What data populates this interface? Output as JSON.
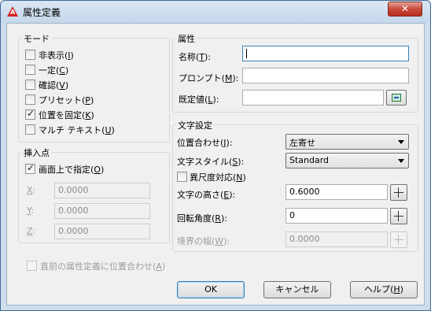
{
  "window": {
    "title": "属性定義",
    "close_label": "✕"
  },
  "mode": {
    "title": "モード",
    "items": [
      {
        "label": "非表示",
        "key": "I",
        "checked": false
      },
      {
        "label": "一定",
        "key": "C",
        "checked": false
      },
      {
        "label": "確認",
        "key": "V",
        "checked": false
      },
      {
        "label": "プリセット",
        "key": "P",
        "checked": false
      },
      {
        "label": "位置を固定",
        "key": "K",
        "checked": true
      },
      {
        "label": "マルチ テキスト",
        "key": "U",
        "checked": false
      }
    ]
  },
  "insertion": {
    "title": "挿入点",
    "specify_on_screen": {
      "label": "画面上で指定",
      "key": "O",
      "checked": true
    },
    "x": {
      "label": "X",
      "suffix": ":",
      "value": "0.0000"
    },
    "y": {
      "label": "Y",
      "suffix": ":",
      "value": "0.0000"
    },
    "z": {
      "label": "Z",
      "suffix": ":",
      "value": "0.0000"
    }
  },
  "attribute": {
    "title": "属性",
    "tag": {
      "label": "名称",
      "key": "T",
      "value": ""
    },
    "prompt": {
      "label": "プロンプト",
      "key": "M",
      "value": ""
    },
    "default": {
      "label": "既定値",
      "key": "L",
      "value": ""
    }
  },
  "text_settings": {
    "title": "文字設定",
    "justification": {
      "label": "位置合わせ",
      "key": "J",
      "value": "左寄せ"
    },
    "text_style": {
      "label": "文字スタイル",
      "key": "S",
      "value": "Standard"
    },
    "annotative": {
      "label": "異尺度対応",
      "key": "N",
      "checked": false
    },
    "text_height": {
      "label": "文字の高さ",
      "key": "E",
      "value": "0.6000"
    },
    "rotation": {
      "label": "回転角度",
      "key": "R",
      "value": "0"
    },
    "boundary_width": {
      "label": "境界の幅",
      "key": "W",
      "value": "0.0000"
    }
  },
  "align_below": {
    "label": "直前の属性定義に位置合わせ",
    "key": "A",
    "checked": false
  },
  "buttons": {
    "ok": "OK",
    "cancel": "キャンセル",
    "help": {
      "label": "ヘルプ",
      "key": "H"
    }
  }
}
